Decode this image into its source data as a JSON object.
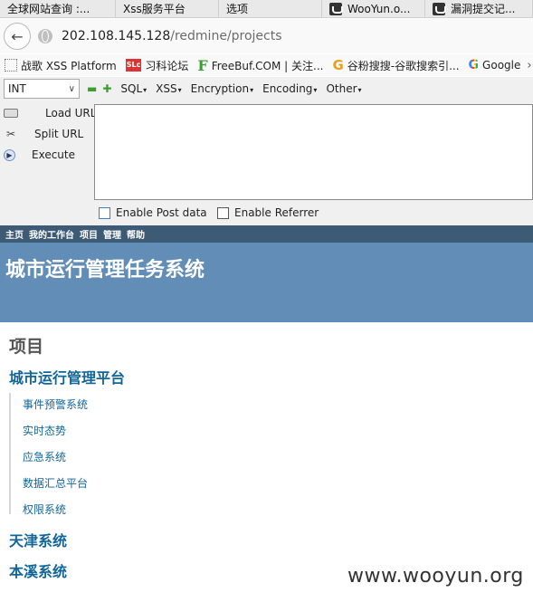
{
  "tabs": [
    {
      "label": "全球网站查询 :...",
      "width": 128
    },
    {
      "label": "Xss服务平台",
      "width": 114
    },
    {
      "label": "选项",
      "width": 114
    },
    {
      "label": "WooYun.o...",
      "width": 114,
      "icon": "wooyun-icon"
    },
    {
      "label": "漏洞提交记...",
      "width": 119,
      "icon": "wooyun-icon"
    }
  ],
  "navbar": {
    "url_host": "202.108.145.128",
    "url_path": "/redmine/projects"
  },
  "bookmarks": [
    {
      "label": "战歌 XSS Platform",
      "icon": "dotted-box-icon"
    },
    {
      "label": "习科论坛",
      "icon": "slc-icon"
    },
    {
      "label": "FreeBuf.COM | 关注...",
      "icon": "freebuf-icon"
    },
    {
      "label": "谷粉搜搜-谷歌搜索引...",
      "icon": "google-orange-icon"
    },
    {
      "label": "Google",
      "icon": "google-icon"
    }
  ],
  "hackbar": {
    "select_value": "INT",
    "menus": [
      "SQL",
      "XSS",
      "Encryption",
      "Encoding",
      "Other"
    ],
    "actions": [
      {
        "label": "Load URL",
        "icon": "load-url-icon"
      },
      {
        "label": "Split URL",
        "icon": "split-url-icon"
      },
      {
        "label": "Execute",
        "icon": "execute-icon"
      }
    ],
    "textarea_value": "",
    "checkboxes": [
      {
        "label": "Enable Post data",
        "checked": false
      },
      {
        "label": "Enable Referrer",
        "checked": false
      }
    ]
  },
  "redmine": {
    "top_menu": [
      "主页",
      "我的工作台",
      "项目",
      "管理",
      "帮助"
    ],
    "site_title": "城市运行管理任务系统",
    "page_title": "项目",
    "projects": [
      {
        "name": "城市运行管理平台",
        "subprojects": [
          "事件预警系统",
          "实时态势",
          "应急系统",
          "数据汇总平台",
          "权限系统"
        ]
      },
      {
        "name": "天津系统",
        "subprojects": []
      },
      {
        "name": "本溪系统",
        "subprojects": []
      }
    ]
  },
  "watermark": "www.wooyun.org",
  "colors": {
    "top_menu_bg": "#3e5b76",
    "header_bg": "#628db6",
    "link": "#169"
  }
}
